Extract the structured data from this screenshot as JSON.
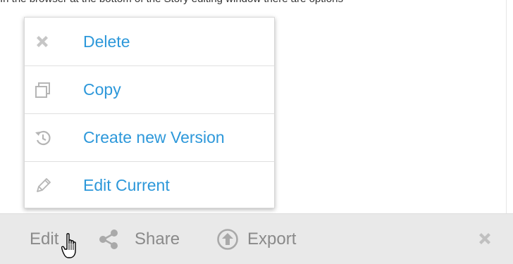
{
  "page": {
    "top_text": "In the browser at the bottom of the Story editing window there are options"
  },
  "menu": {
    "items": [
      {
        "label": "Delete",
        "icon": "close-x-icon"
      },
      {
        "label": "Copy",
        "icon": "copy-icon"
      },
      {
        "label": "Create new Version",
        "icon": "history-icon"
      },
      {
        "label": "Edit Current",
        "icon": "pencil-icon"
      }
    ]
  },
  "bottom_bar": {
    "edit_label": "Edit",
    "share_label": "Share",
    "export_label": "Export",
    "close_icon": "close-x-icon"
  },
  "colors": {
    "accent": "#2d98da",
    "icon_grey": "#bcbcbc",
    "bar_text": "#8a8a8a",
    "bar_bg": "#e9e9e9"
  }
}
